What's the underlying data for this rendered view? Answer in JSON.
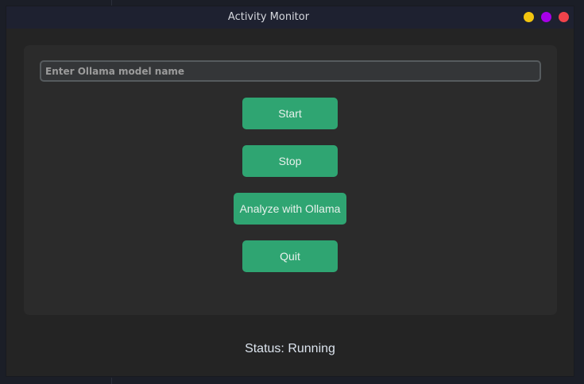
{
  "window": {
    "title": "Activity Monitor",
    "controls": [
      {
        "name": "minimize",
        "color": "#f2c40f"
      },
      {
        "name": "maximize",
        "color": "#a700e8"
      },
      {
        "name": "close",
        "color": "#f1434b"
      }
    ]
  },
  "form": {
    "model_input": {
      "placeholder": "Enter Ollama model name",
      "value": ""
    }
  },
  "buttons": {
    "start": "Start",
    "stop": "Stop",
    "analyze": "Analyze with Ollama",
    "quit": "Quit"
  },
  "status": {
    "text": "Status: Running"
  },
  "colors": {
    "accent": "#2fa572",
    "panel": "#2b2b2b",
    "window_bg": "#242424",
    "titlebar": "#1e2130"
  }
}
